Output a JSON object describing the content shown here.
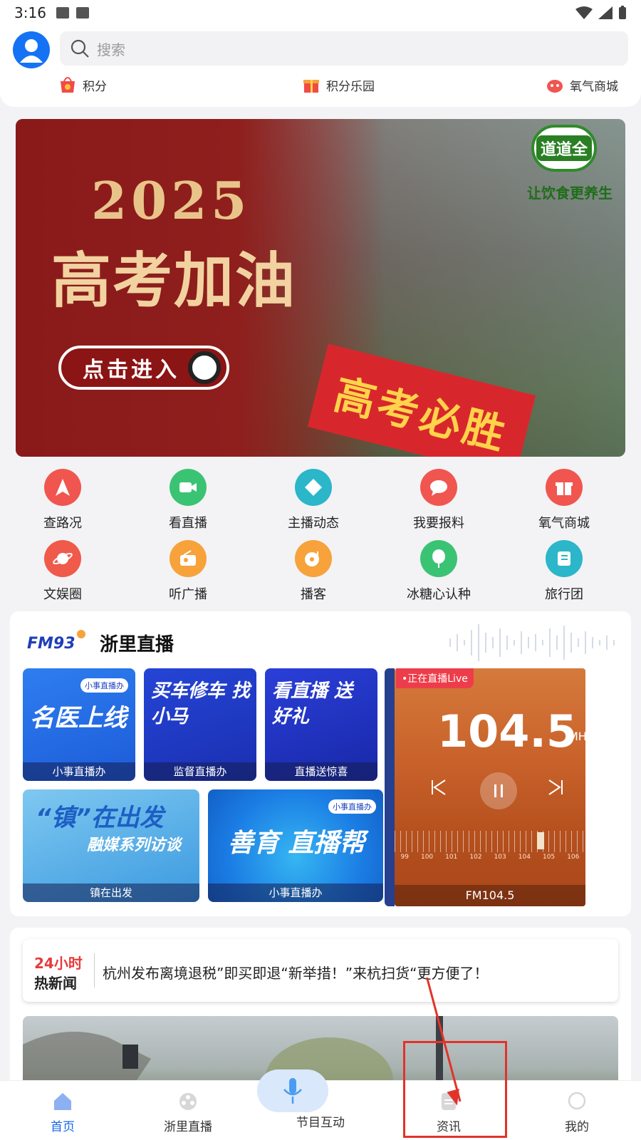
{
  "status_bar": {
    "time": "3:16"
  },
  "search": {
    "placeholder": "搜索"
  },
  "quick_links": [
    {
      "label": "积分",
      "icon": "points-bag-icon"
    },
    {
      "label": "积分乐园",
      "icon": "gift-box-icon"
    },
    {
      "label": "氧气商城",
      "icon": "oxygen-mall-icon"
    }
  ],
  "banner": {
    "year": "2025",
    "slogan": "高考加油",
    "sign": "高考必胜",
    "cta": "点击进入",
    "brand": "道道全",
    "brand_tagline": "让饮食更养生"
  },
  "grid": [
    {
      "label": "查路况",
      "icon": "navigation-icon",
      "color": "#f0564f"
    },
    {
      "label": "看直播",
      "icon": "video-camera-icon",
      "color": "#3bc374"
    },
    {
      "label": "主播动态",
      "icon": "diamond-icon",
      "color": "#2bb6c9"
    },
    {
      "label": "我要报料",
      "icon": "chat-bubble-icon",
      "color": "#f0564f"
    },
    {
      "label": "氧气商城",
      "icon": "gift-icon",
      "color": "#f0564f"
    },
    {
      "label": "文娱圈",
      "icon": "planet-icon",
      "color": "#ef5a4a"
    },
    {
      "label": "听广播",
      "icon": "radio-icon",
      "color": "#f7a23a"
    },
    {
      "label": "播客",
      "icon": "podcast-icon",
      "color": "#f7a23a"
    },
    {
      "label": "冰糖心认种",
      "icon": "tree-icon",
      "color": "#3bc374"
    },
    {
      "label": "旅行团",
      "icon": "travel-book-icon",
      "color": "#2bb6c9"
    }
  ],
  "live": {
    "title": "浙里直播",
    "logo_text": "FM93",
    "tiles": [
      {
        "headline": "名医上线",
        "caption": "小事直播办",
        "badge": "小事直播办"
      },
      {
        "headline": "买车修车 找小马",
        "caption": "监督直播办"
      },
      {
        "headline": "看直播 送好礼",
        "caption": "直播送惊喜"
      },
      {
        "headline": "“镇”在出发",
        "sub": "融媒系列访谈",
        "caption": "镇在出发"
      },
      {
        "headline": "善育 直播帮",
        "caption": "小事直播办",
        "badge": "小事直播办"
      }
    ],
    "radio": {
      "live_tag": "•正在直播Live",
      "frequency": "104.5",
      "unit": "MHz",
      "scale": [
        "99",
        "100",
        "101",
        "102",
        "103",
        "104",
        "105",
        "106"
      ],
      "caption": "FM104.5",
      "prev_icon": "skip-previous-icon",
      "pause_icon": "pause-icon",
      "next_icon": "skip-next-icon"
    }
  },
  "news": {
    "tag_line1": "24小时",
    "tag_line2": "热新闻",
    "headline": "杭州发布离境退税”即买即退“新举措！”来杭扫货“更方便了！"
  },
  "bottom_nav": [
    {
      "label": "首页",
      "icon": "home-icon",
      "active": true
    },
    {
      "label": "浙里直播",
      "icon": "film-reel-icon",
      "active": false
    },
    {
      "label": "节目互动",
      "icon": "microphone-icon",
      "active": false
    },
    {
      "label": "资讯",
      "icon": "news-doc-icon",
      "active": false
    },
    {
      "label": "我的",
      "icon": "profile-icon",
      "active": false
    }
  ]
}
